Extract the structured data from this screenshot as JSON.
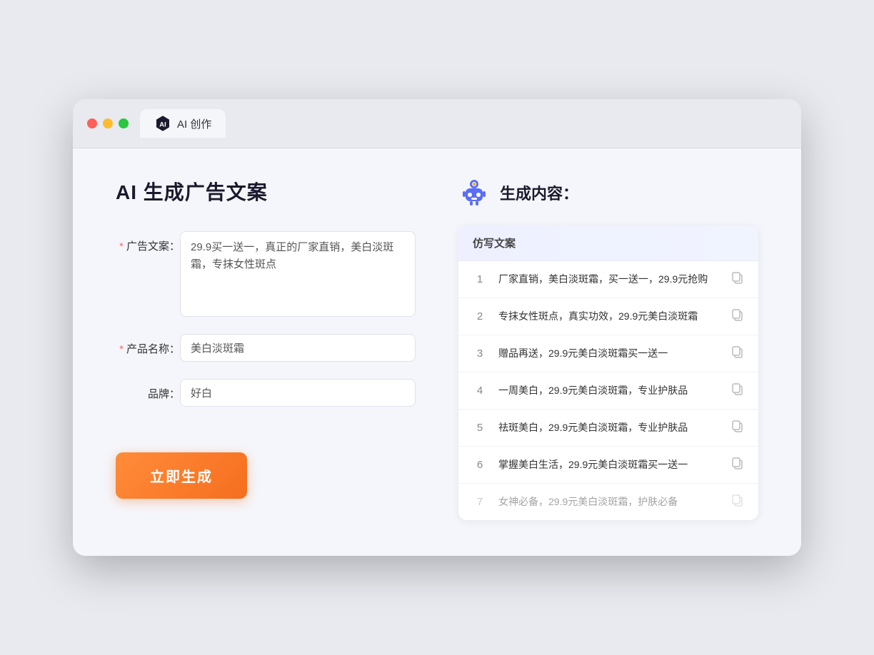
{
  "window": {
    "tab_label": "AI 创作"
  },
  "page": {
    "title": "AI 生成广告文案"
  },
  "form": {
    "ad_copy_label": "广告文案：",
    "ad_copy_required": true,
    "ad_copy_value": "29.9买一送一，真正的厂家直销，美白淡斑霜，专抹女性斑点",
    "product_name_label": "产品名称：",
    "product_name_required": true,
    "product_name_value": "美白淡斑霜",
    "brand_label": "品牌：",
    "brand_value": "好白",
    "generate_button_label": "立即生成"
  },
  "results": {
    "icon_label": "robot-icon",
    "title": "生成内容：",
    "column_header": "仿写文案",
    "items": [
      {
        "number": "1",
        "text": "厂家直销，美白淡斑霜，买一送一，29.9元抢购",
        "faded": false
      },
      {
        "number": "2",
        "text": "专抹女性斑点，真实功效，29.9元美白淡斑霜",
        "faded": false
      },
      {
        "number": "3",
        "text": "赠品再送，29.9元美白淡斑霜买一送一",
        "faded": false
      },
      {
        "number": "4",
        "text": "一周美白，29.9元美白淡斑霜，专业护肤品",
        "faded": false
      },
      {
        "number": "5",
        "text": "祛斑美白，29.9元美白淡斑霜，专业护肤品",
        "faded": false
      },
      {
        "number": "6",
        "text": "掌握美白生活，29.9元美白淡斑霜买一送一",
        "faded": false
      },
      {
        "number": "7",
        "text": "女神必备，29.9元美白淡斑霜，护肤必备",
        "faded": true
      }
    ]
  }
}
